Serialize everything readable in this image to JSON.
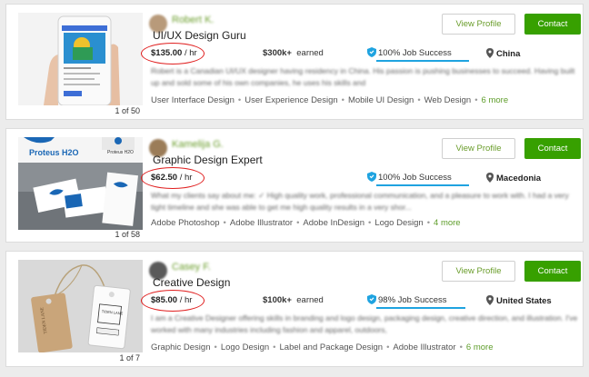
{
  "cards": [
    {
      "name": "Robert K.",
      "title": "UI/UX Design Guru",
      "rate": "$135.00",
      "rate_unit": "/ hr",
      "earned_amount": "$300k+",
      "earned_label": "earned",
      "job_success": "100% Job Success",
      "location": "China",
      "description": "Robert is a Canadian UI/UX designer having residency in China. His passion is pushing businesses to succeed. Having built up and sold some of his own companies, he uses his skills and",
      "skills": [
        "User Interface Design",
        "User Experience Design",
        "Mobile UI Design",
        "Web Design"
      ],
      "more": "6 more",
      "counter": "1 of 50",
      "view_label": "View Profile",
      "contact_label": "Contact"
    },
    {
      "name": "Kamelija G.",
      "title": "Graphic Design Expert",
      "rate": "$62.50",
      "rate_unit": "/ hr",
      "job_success": "100% Job Success",
      "location": "Macedonia",
      "description": "What my clients say about me: ✓ High quality work, professional communication, and a pleasure to work with. I had a very tight timeline and she was able to get me high quality results in a very shor...",
      "skills": [
        "Adobe Photoshop",
        "Adobe Illustrator",
        "Adobe InDesign",
        "Logo Design"
      ],
      "more": "4 more",
      "counter": "1 of 58",
      "thumb_brand": "Proteus H2O",
      "view_label": "View Profile",
      "contact_label": "Contact"
    },
    {
      "name": "Casey F.",
      "title": "Creative Design",
      "rate": "$85.00",
      "rate_unit": "/ hr",
      "earned_amount": "$100k+",
      "earned_label": "earned",
      "job_success": "98% Job Success",
      "location": "United States",
      "description": "I am a Creative Designer offering skills in branding and logo design, packaging design, creative direction, and illustration. I've worked with many industries including fashion and apparel, outdoors,",
      "skills": [
        "Graphic Design",
        "Logo Design",
        "Label and Package Design",
        "Adobe Illustrator"
      ],
      "more": "6 more",
      "counter": "1 of 7",
      "thumb_brand": "TIDEN LANE",
      "view_label": "View Profile",
      "contact_label": "Contact"
    }
  ],
  "colors": {
    "accent_green": "#37a000",
    "link_green": "#6a9d2b",
    "success_blue": "#1fa3e0",
    "highlight_red": "#e01e1e"
  }
}
